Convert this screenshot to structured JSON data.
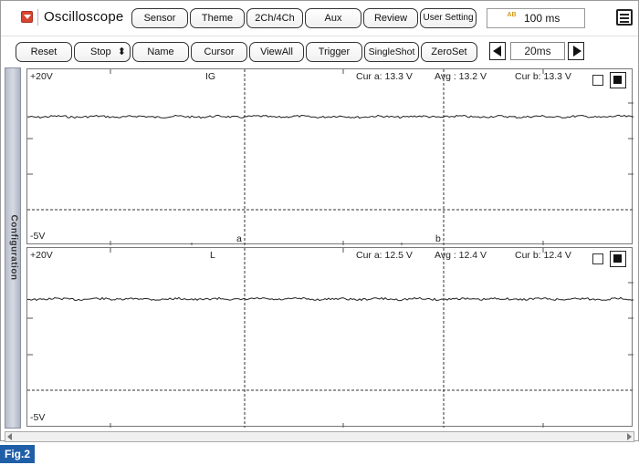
{
  "app": {
    "title": "Oscilloscope"
  },
  "top_buttons": [
    "Sensor",
    "Theme",
    "2Ch/4Ch",
    "Aux",
    "Review",
    "User Setting"
  ],
  "sample_time": "100 ms",
  "ab_icon": "AB",
  "controls": {
    "reset": "Reset",
    "stop": "Stop",
    "stop_arrows": "⬍",
    "name": "Name",
    "cursor": "Cursor",
    "view_all": "ViewAll",
    "trigger": "Trigger",
    "single_shot": "SingleShot",
    "zero_set": "ZeroSet",
    "time_div": "20ms"
  },
  "side_tab": "Configuration",
  "channels": [
    {
      "name": "IG",
      "y_max": "+20V",
      "y_min": "-5V",
      "cur_a": "Cur a: 13.3 V",
      "avg": "Avg : 13.2 V",
      "cur_b": "Cur b: 13.3 V",
      "cursor_a": "a",
      "cursor_b": "b"
    },
    {
      "name": "L",
      "y_max": "+20V",
      "y_min": "-5V",
      "cur_a": "Cur a: 12.5 V",
      "avg": "Avg : 12.4 V",
      "cur_b": "Cur b: 12.4 V"
    }
  ],
  "figure_label": "Fig.2",
  "icons": {
    "app": "dropdown-arrow-icon",
    "menu": "menu-icon",
    "prev": "triangle-left-icon",
    "next": "triangle-right-icon"
  }
}
